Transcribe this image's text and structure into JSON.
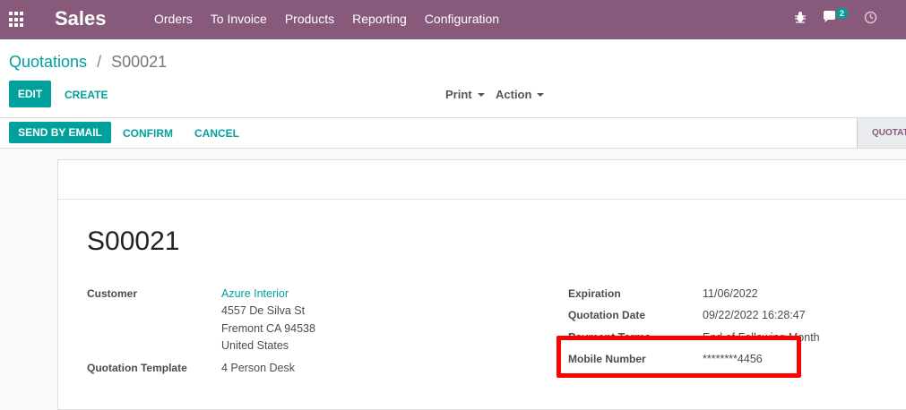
{
  "navbar": {
    "app_title": "Sales",
    "menu": [
      "Orders",
      "To Invoice",
      "Products",
      "Reporting",
      "Configuration"
    ],
    "chat_badge": "2",
    "icons": [
      "apps-grid-icon",
      "bug-icon",
      "chat-icon",
      "clock-icon"
    ],
    "color": "#875a7b"
  },
  "breadcrumb": {
    "parent": "Quotations",
    "separator": "/",
    "current": "S00021"
  },
  "toolbar": {
    "edit": "EDIT",
    "create": "CREATE",
    "print": "Print",
    "action": "Action"
  },
  "statusbar": {
    "send_email": "SEND BY EMAIL",
    "confirm": "CONFIRM",
    "cancel": "CANCEL",
    "stage": "QUOTAT"
  },
  "form": {
    "title": "S00021",
    "customer_label": "Customer",
    "customer_name": "Azure Interior",
    "address_line1": "4557 De Silva St",
    "address_line2": "Fremont CA 94538",
    "address_line3": "United States",
    "template_label": "Quotation Template",
    "template_value": "4 Person Desk",
    "expiration_label": "Expiration",
    "expiration_value": "11/06/2022",
    "quotation_date_label": "Quotation Date",
    "quotation_date_value": "09/22/2022 16:28:47",
    "payment_terms_label": "Payment Terms",
    "payment_terms_value": "End of Following Month",
    "mobile_label": "Mobile Number",
    "mobile_value": "********4456"
  },
  "accent_color": "#00a09d",
  "highlight_color": "#ff0000"
}
